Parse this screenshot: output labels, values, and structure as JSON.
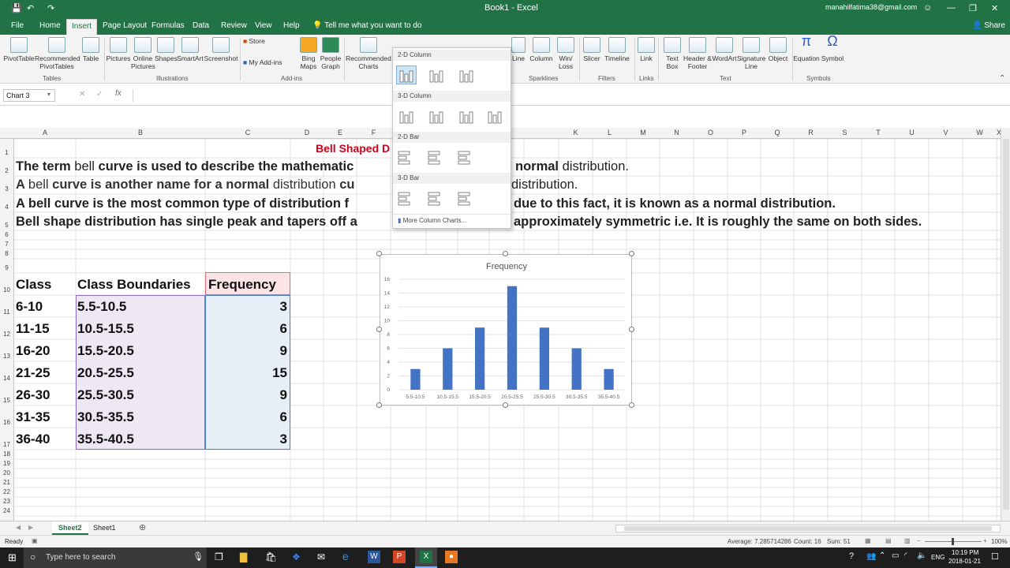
{
  "window": {
    "title": "Book1 - Excel",
    "user": "manahilfatima38@gmail.com",
    "share": "Share"
  },
  "tabs": [
    "File",
    "Home",
    "Insert",
    "Page Layout",
    "Formulas",
    "Data",
    "Review",
    "View",
    "Help",
    "Tell me what you want to do"
  ],
  "ribbon": {
    "buttons": [
      "PivotTable",
      "Recommended PivotTables",
      "Table",
      "Pictures",
      "Online Pictures",
      "Shapes",
      "SmartArt",
      "Screenshot",
      "Store",
      "My Add-ins",
      "Bing Maps",
      "People Graph",
      "Recommended Charts",
      "Line",
      "Column",
      "Win/ Loss",
      "Slicer",
      "Timeline",
      "Link",
      "Text Box",
      "Header & Footer",
      "WordArt",
      "Signature Line",
      "Object",
      "Equation",
      "Symbol"
    ],
    "groups": [
      "Tables",
      "Illustrations",
      "Add-ins",
      "Sparklines",
      "Filters",
      "Links",
      "Text",
      "Symbols"
    ]
  },
  "namebox": "Chart 3",
  "dropdown": {
    "sections": [
      "2-D Column",
      "3-D Column",
      "2-D Bar",
      "3-D Bar"
    ],
    "more": "More Column Charts..."
  },
  "columns": [
    "A",
    "B",
    "C",
    "D",
    "E",
    "F",
    "",
    "",
    "",
    "",
    "",
    "K",
    "L",
    "M",
    "N",
    "O",
    "P",
    "Q",
    "R",
    "S",
    "T",
    "U",
    "V",
    "W",
    "X"
  ],
  "rows": [
    "1",
    "2",
    "3",
    "4",
    "5",
    "6",
    "7",
    "8",
    "9",
    "10",
    "11",
    "12",
    "13",
    "14",
    "15",
    "16",
    "17",
    "18",
    "19",
    "20",
    "21",
    "22",
    "23",
    "24"
  ],
  "text": {
    "title": "Bell Shaped D",
    "l2a": "The term ",
    "l2b": "bell",
    "l2c": " curve is used to describe the mathematic",
    "l2d": "normal",
    "l2e": " distribution.",
    "l3a": "A ",
    "l3b": "bell",
    "l3c": " curve is another name for a normal ",
    "l3d": "distribution",
    "l3e": " cu",
    "l3f": "distribution.",
    "l4a": "A bell curve is the most common type of distribution f",
    "l4b": "due to this fact, it is known as a normal distribution.",
    "l5a": "Bell shape distribution has single peak and tapers off a",
    "l5b": "approximately symmetric i.e. It is roughly the same on both sides."
  },
  "table": {
    "headers": [
      "Class",
      "Class Boundaries",
      "Frequency"
    ],
    "rows": [
      [
        "6-10",
        "5.5-10.5",
        "3"
      ],
      [
        "11-15",
        "10.5-15.5",
        "6"
      ],
      [
        "16-20",
        "15.5-20.5",
        "9"
      ],
      [
        "21-25",
        "20.5-25.5",
        "15"
      ],
      [
        "26-30",
        "25.5-30.5",
        "9"
      ],
      [
        "31-35",
        "30.5-35.5",
        "6"
      ],
      [
        "36-40",
        "35.5-40.5",
        "3"
      ]
    ]
  },
  "chart_data": {
    "type": "bar",
    "title": "Frequency",
    "categories": [
      "5.5-10.5",
      "10.5-15.5",
      "15.5-20.5",
      "20.5-25.5",
      "25.5-30.5",
      "30.5-35.5",
      "35.5-40.5"
    ],
    "values": [
      3,
      6,
      9,
      15,
      9,
      6,
      3
    ],
    "yticks": [
      "0",
      "2",
      "4",
      "6",
      "8",
      "10",
      "12",
      "14",
      "16"
    ],
    "ylim": [
      0,
      16
    ],
    "grid": true,
    "color": "#4472c4"
  },
  "sheets": [
    "Sheet2",
    "Sheet1"
  ],
  "status": {
    "ready": "Ready",
    "average": "Average: 7.285714286",
    "count": "Count: 16",
    "sum": "Sum: 51",
    "zoom": "100%"
  },
  "taskbar": {
    "search": "Type here to search",
    "time": "10:19 PM",
    "date": "2018-01-21",
    "lang": "ENG"
  }
}
